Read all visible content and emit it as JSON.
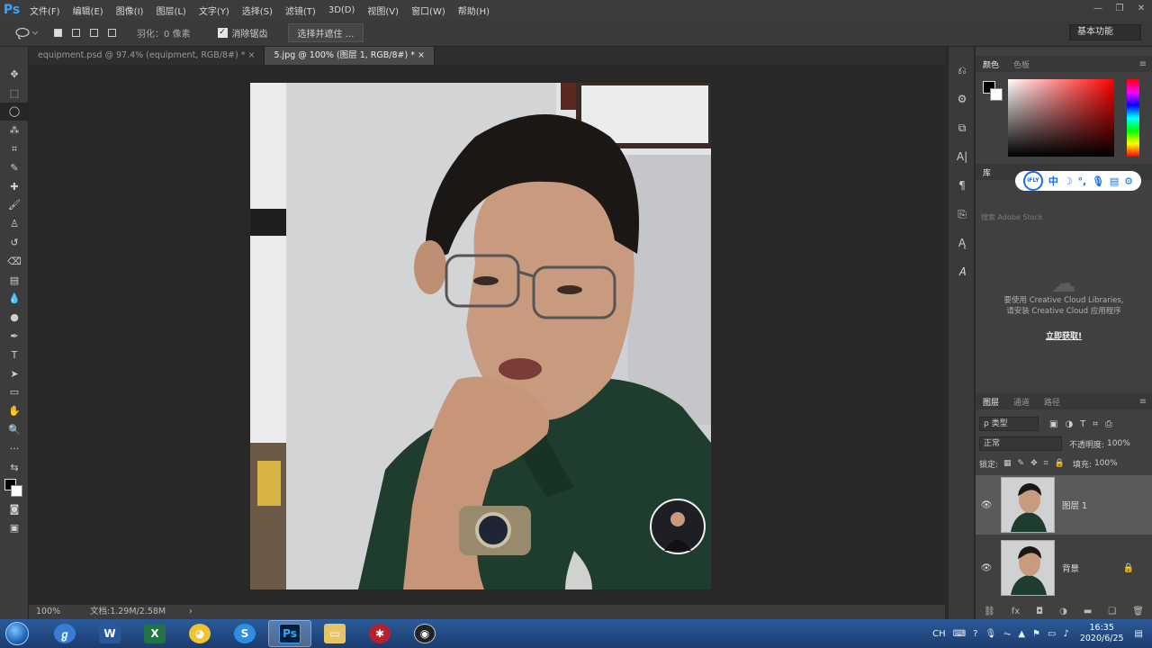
{
  "menubar": {
    "logo": "Ps",
    "items": [
      "文件(F)",
      "编辑(E)",
      "图像(I)",
      "图层(L)",
      "文字(Y)",
      "选择(S)",
      "滤镜(T)",
      "3D(D)",
      "视图(V)",
      "窗口(W)",
      "帮助(H)"
    ]
  },
  "options": {
    "feather": "羽化：0 像素",
    "antialias": "消除锯齿",
    "select_mask": "选择并遮住 ...",
    "workspace": "基本功能"
  },
  "tabs": [
    {
      "label": "equipment.psd @ 97.4% (equipment, RGB/8#) *  ×",
      "active": false
    },
    {
      "label": "5.jpg @ 100% (图层 1, RGB/8#) *  ×",
      "active": true
    }
  ],
  "status": {
    "zoom": "100%",
    "doc": "文档:1.29M/2.58M",
    "arrow": "›"
  },
  "color_panel": {
    "tabs": [
      "颜色",
      "色板"
    ]
  },
  "library_panel": {
    "tab": "库",
    "search_placeholder": "搜索 Adobe Stock",
    "message_line1": "要使用 Creative Cloud Libraries,",
    "message_line2": "请安装 Creative Cloud 应用程序",
    "link": "立即获取!"
  },
  "ifly": {
    "logo": "iFLY",
    "items": [
      "中",
      "☽",
      "°,",
      "🎙",
      "▤",
      "⚙"
    ]
  },
  "layers_panel": {
    "tabs": [
      "图层",
      "通道",
      "路径"
    ],
    "filter": "ρ 类型",
    "blend_mode": "正常",
    "opacity_label": "不透明度:",
    "opacity": "100%",
    "lock_label": "锁定:",
    "fill_label": "填充:",
    "fill": "100%",
    "layers": [
      {
        "name": "图层 1",
        "active": true,
        "locked": false
      },
      {
        "name": "背景",
        "active": false,
        "locked": true
      }
    ]
  },
  "taskbar": {
    "tray_lang": "CH",
    "time": "16:35",
    "date": "2020/6/25"
  },
  "colors": {
    "ps_blue": "#31a8ff",
    "shirt": "#1f3d2e",
    "skin": "#c89a7e",
    "hair": "#1b1714"
  }
}
